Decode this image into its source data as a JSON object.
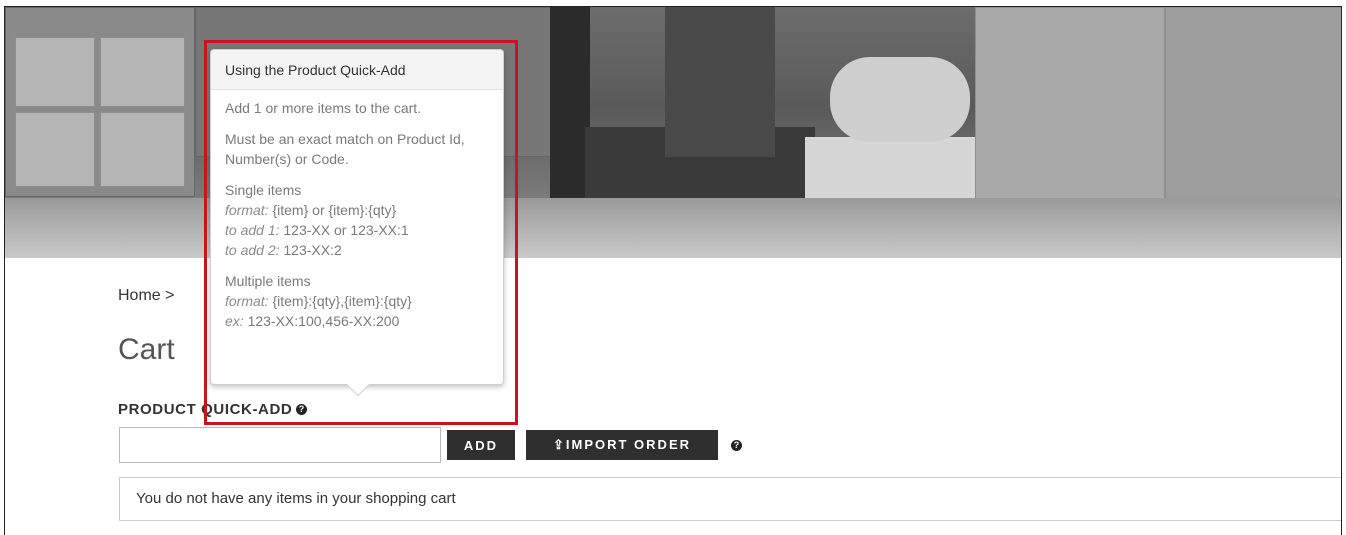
{
  "breadcrumb": {
    "home": "Home",
    "separator": ">"
  },
  "page": {
    "title": "Cart"
  },
  "quick_add": {
    "heading": "PRODUCT QUICK-ADD",
    "help_icon": "question-circle-icon",
    "input_value": "",
    "input_placeholder": "",
    "add_label": "ADD",
    "import_label": "IMPORT ORDER",
    "import_icon": "upload-icon"
  },
  "cart": {
    "empty_message": "You do not have any items in your shopping cart"
  },
  "popover": {
    "title": "Using the Product Quick-Add",
    "line1": "Add 1 or more items to the cart.",
    "line2": "Must be an exact match on Product Id, Number(s) or Code.",
    "single_heading": "Single items",
    "single_format_label": "format:",
    "single_format_value": "{item} or {item}:{qty}",
    "single_add1_label": "to add 1:",
    "single_add1_value": "123-XX or 123-XX:1",
    "single_add2_label": "to add 2:",
    "single_add2_value": "123-XX:2",
    "multi_heading": "Multiple items",
    "multi_format_label": "format:",
    "multi_format_value": "{item}:{qty},{item}:{qty}",
    "multi_ex_label": "ex:",
    "multi_ex_value": "123-XX:100,456-XX:200"
  },
  "colors": {
    "highlight": "#c8141e",
    "button_bg": "#2f2f2f"
  }
}
